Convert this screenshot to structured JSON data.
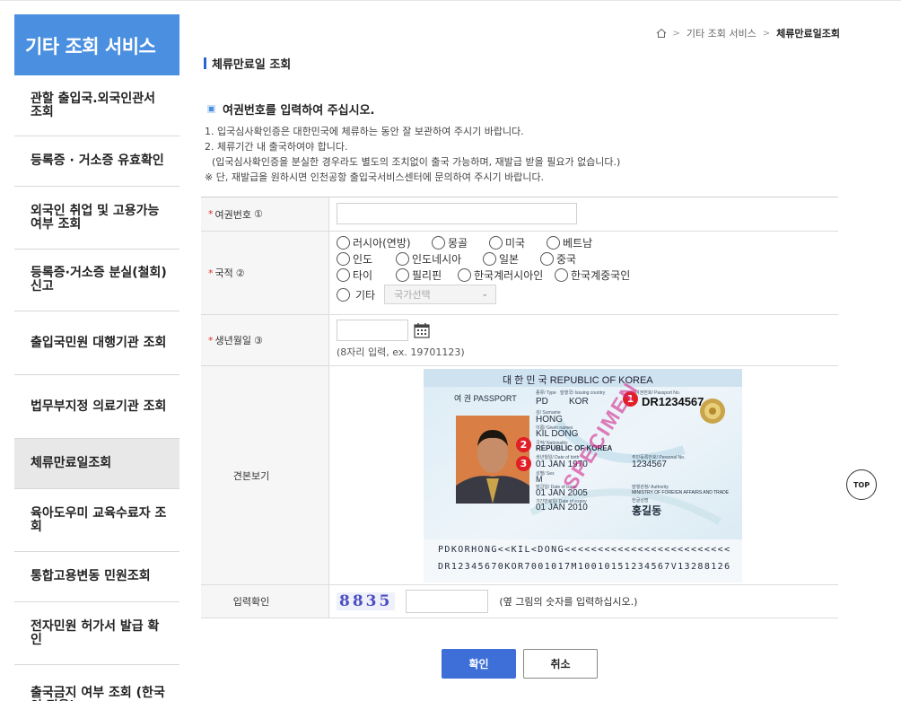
{
  "sidebar": {
    "title": "기타 조회 서비스",
    "items": [
      {
        "label": "관할 출입국.외국인관서 조회"
      },
      {
        "label": "등록증 · 거소증 유효확인"
      },
      {
        "label": "외국인 취업 및 고용가능 여부 조회"
      },
      {
        "label": "등록증·거소증 분실(철회) 신고"
      },
      {
        "label": "출입국민원 대행기관 조회"
      },
      {
        "label": "법무부지정 의료기관 조회"
      },
      {
        "label": "체류만료일조회",
        "active": true
      },
      {
        "label": "육아도우미 교육수료자 조회"
      },
      {
        "label": "통합고용변동 민원조회"
      },
      {
        "label": "전자민원 허가서 발급 확인"
      },
      {
        "label": "출국금지 여부 조회 (한국인 전용)"
      }
    ]
  },
  "breadcrumb": {
    "items": [
      "기타 조회 서비스",
      "체류만료일조회"
    ]
  },
  "page": {
    "title": "체류만료일 조회",
    "instruction": "여권번호를 입력하여 주십시오.",
    "notes": [
      "1. 입국심사확인증은 대한민국에 체류하는 동안 잘 보관하여 주시기 바랍니다.",
      "2. 체류기간 내 출국하여야 합니다.",
      "(입국심사확인증을 분실한 경우라도 별도의 조치없이 출국 가능하며, 재발급 받을 필요가 없습니다.)",
      "※ 단, 재발급을 원하시면 인천공항 출입국서비스센터에 문의하여 주시기 바랍니다."
    ]
  },
  "form": {
    "passport_label": "여권번호",
    "passport_num": "①",
    "passport_value": "",
    "nationality_label": "국적",
    "nationality_num": "②",
    "nationality_rows": [
      [
        "러시아(연방)",
        "몽골",
        "미국",
        "베트남"
      ],
      [
        "인도",
        "인도네시아",
        "일본",
        "중국"
      ],
      [
        "타이",
        "필리핀",
        "한국계러시아인",
        "한국계중국인"
      ]
    ],
    "other_label": "기타",
    "country_select_placeholder": "국가선택",
    "birth_label": "생년월일",
    "birth_num": "③",
    "birth_value": "",
    "birth_hint": "(8자리 입력, ex. 19701123)",
    "sample_label": "견본보기",
    "captcha_label": "입력확인",
    "captcha_code": "8835",
    "captcha_value": "",
    "captcha_hint": "(옆 그림의 숫자를 입력하십시오.)"
  },
  "passport_sample": {
    "header": "대 한 민 국   REPUBLIC OF KOREA",
    "type_word": "여 권  PASSPORT",
    "type_caption": "종류/ Type",
    "country_caption": "발행국/ Issuing country",
    "number_caption": "여권번호/ Passport No.",
    "type": "PD",
    "country": "KOR",
    "number": "DR1234567",
    "surname_caption": "성/ Surname",
    "surname": "HONG",
    "given_caption": "이름/ Given names",
    "given": "KIL DONG",
    "nationality_caption": "국적/ Nationality",
    "nationality": "REPUBLIC OF KOREA",
    "dob_caption": "생년월일/ Date of birth",
    "dob": "01 JAN 1970",
    "personal_caption": "주민등록번호/ Personal No.",
    "personal_no": "1234567",
    "sex_caption": "성별/ Sex",
    "sex": "M",
    "issue_caption": "발급일/ Date of issue",
    "issue": "01 JAN 2005",
    "authority_caption": "발행관청/ Authority",
    "authority": "MINISTRY OF FOREIGN AFFAIRS AND TRADE",
    "expiry_caption": "기간만료일/ Date of expiry",
    "expiry": "01 JAN 2010",
    "signature_caption": "한글성명",
    "korean_name": "홍길동",
    "specimen": "SPECIMEN",
    "mrz1": "PDKORHONG<<KIL<DONG<<<<<<<<<<<<<<<<<<<<<<<<<",
    "mrz2": "DR12345670KOR7001017M10010151234567V13288126",
    "badges": [
      "1",
      "2",
      "3"
    ]
  },
  "buttons": {
    "confirm": "확인",
    "cancel": "취소",
    "top": "TOP"
  },
  "colors": {
    "accent": "#4a8fe0",
    "confirm_button": "#3e6fd8",
    "required": "#e0312b",
    "badge": "#e21f26"
  }
}
